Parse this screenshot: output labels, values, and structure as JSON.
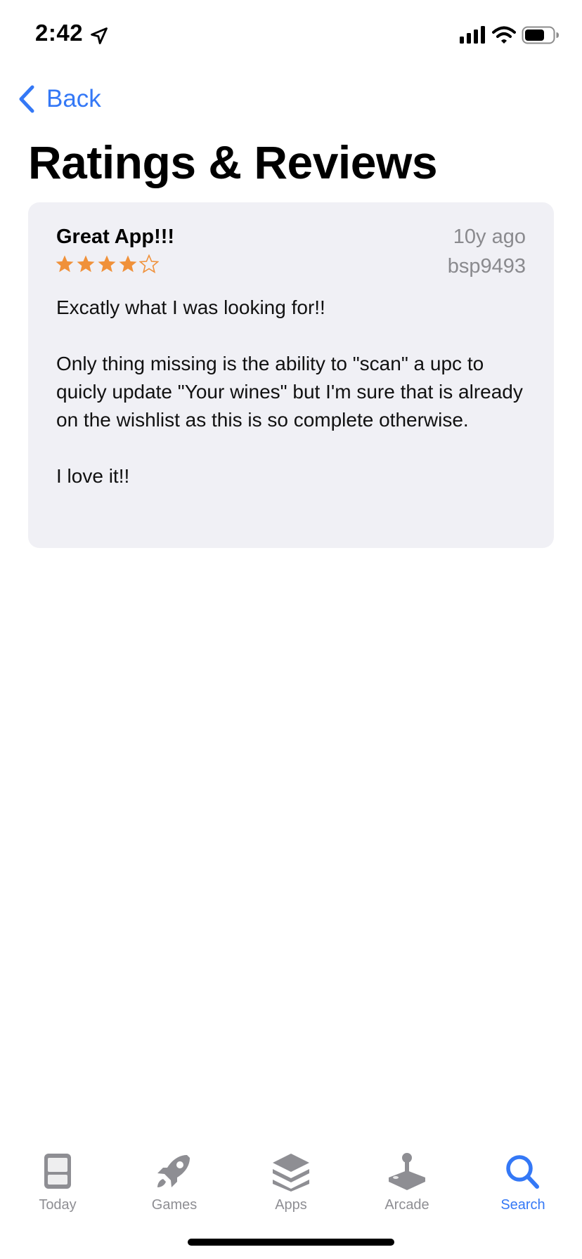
{
  "status_bar": {
    "time": "2:42",
    "icons": [
      "location-arrow-icon",
      "cellular-signal-icon",
      "wifi-icon",
      "battery-icon"
    ]
  },
  "nav": {
    "back_label": "Back",
    "back_icon": "chevron-left-icon"
  },
  "page": {
    "title": "Ratings & Reviews"
  },
  "review": {
    "title": "Great App!!!",
    "date": "10y ago",
    "author": "bsp9493",
    "rating": 4,
    "max_rating": 5,
    "body": "Excatly what I was looking for!!\n\nOnly thing missing is the ability to \"scan\" a upc to quicly update \"Your wines\" but I'm sure that is already on the wishlist as this is so complete otherwise.\n\nI love it!!"
  },
  "tab_bar": {
    "tabs": [
      {
        "label": "Today",
        "icon": "today-icon",
        "active": false
      },
      {
        "label": "Games",
        "icon": "rocket-icon",
        "active": false
      },
      {
        "label": "Apps",
        "icon": "layers-icon",
        "active": false
      },
      {
        "label": "Arcade",
        "icon": "joystick-icon",
        "active": false
      },
      {
        "label": "Search",
        "icon": "search-icon",
        "active": true
      }
    ]
  },
  "colors": {
    "accent": "#3478f6",
    "star": "#f0913a",
    "card_background": "#f0f0f5",
    "secondary_text": "#8a8a8e",
    "inactive_tab": "#8e8e93"
  }
}
